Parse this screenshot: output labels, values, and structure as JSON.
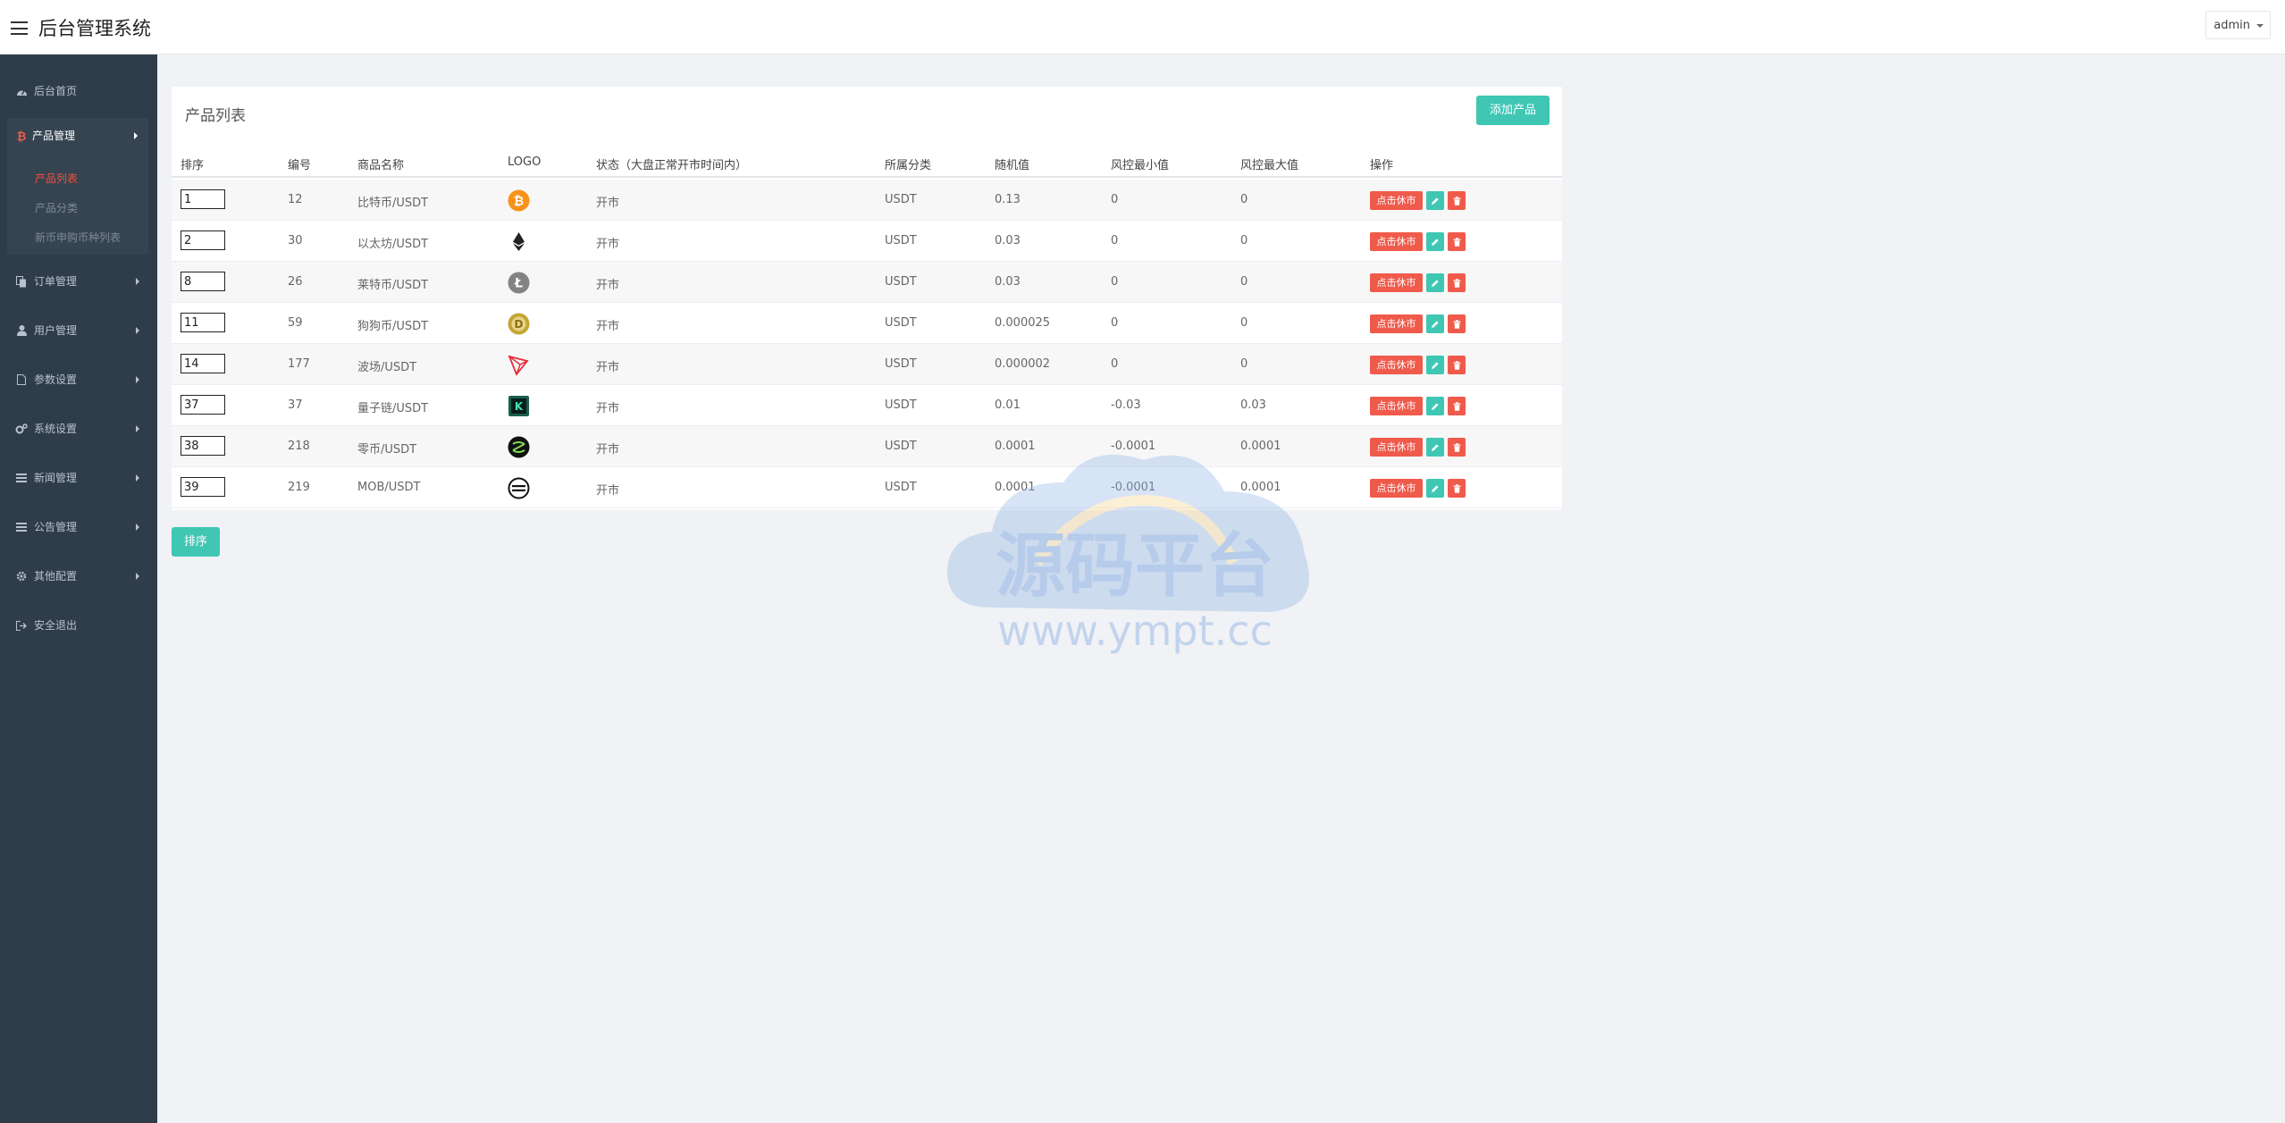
{
  "header": {
    "title": "后台管理系统",
    "user": "admin"
  },
  "sidebar": {
    "items": [
      {
        "label": "后台首页",
        "icon": "dashboard-icon"
      },
      {
        "label": "产品管理",
        "icon": "bitcoin-icon",
        "open": true,
        "children": [
          {
            "label": "产品列表",
            "active": true
          },
          {
            "label": "产品分类"
          },
          {
            "label": "新币申购币种列表"
          }
        ]
      },
      {
        "label": "订单管理",
        "icon": "copy-icon"
      },
      {
        "label": "用户管理",
        "icon": "user-icon"
      },
      {
        "label": "参数设置",
        "icon": "file-icon"
      },
      {
        "label": "系统设置",
        "icon": "cogs-icon"
      },
      {
        "label": "新闻管理",
        "icon": "list-icon"
      },
      {
        "label": "公告管理",
        "icon": "list-icon"
      },
      {
        "label": "其他配置",
        "icon": "gear-icon"
      },
      {
        "label": "安全退出",
        "icon": "sign-out-icon"
      }
    ]
  },
  "panel": {
    "title": "产品列表",
    "add_label": "添加产品",
    "columns": [
      "排序",
      "编号",
      "商品名称",
      "LOGO",
      "状态（大盘正常开市时间内）",
      "所属分类",
      "随机值",
      "风控最小值",
      "风控最大值",
      "操作"
    ],
    "rows": [
      {
        "sort": "1",
        "id": "12",
        "name": "比特币/USDT",
        "logo": "btc-logo",
        "status": "开市",
        "category": "USDT",
        "random": "0.13",
        "min": "0",
        "max": "0"
      },
      {
        "sort": "2",
        "id": "30",
        "name": "以太坊/USDT",
        "logo": "eth-logo",
        "status": "开市",
        "category": "USDT",
        "random": "0.03",
        "min": "0",
        "max": "0"
      },
      {
        "sort": "8",
        "id": "26",
        "name": "莱特币/USDT",
        "logo": "ltc-logo",
        "status": "开市",
        "category": "USDT",
        "random": "0.03",
        "min": "0",
        "max": "0"
      },
      {
        "sort": "11",
        "id": "59",
        "name": "狗狗币/USDT",
        "logo": "doge-logo",
        "status": "开市",
        "category": "USDT",
        "random": "0.000025",
        "min": "0",
        "max": "0"
      },
      {
        "sort": "14",
        "id": "177",
        "name": "波场/USDT",
        "logo": "trx-logo",
        "status": "开市",
        "category": "USDT",
        "random": "0.000002",
        "min": "0",
        "max": "0"
      },
      {
        "sort": "37",
        "id": "37",
        "name": "量子链/USDT",
        "logo": "qtum-logo",
        "status": "开市",
        "category": "USDT",
        "random": "0.01",
        "min": "-0.03",
        "max": "0.03"
      },
      {
        "sort": "38",
        "id": "218",
        "name": "零币/USDT",
        "logo": "zec-logo",
        "status": "开市",
        "category": "USDT",
        "random": "0.0001",
        "min": "-0.0001",
        "max": "0.0001"
      },
      {
        "sort": "39",
        "id": "219",
        "name": "MOB/USDT",
        "logo": "mob-logo",
        "status": "开市",
        "category": "USDT",
        "random": "0.0001",
        "min": "-0.0001",
        "max": "0.0001"
      }
    ],
    "action_halt": "点击休市",
    "action_edit_icon": "pencil-icon",
    "action_delete_icon": "trash-icon"
  },
  "sort_button": "排序",
  "watermark": {
    "title": "源码平台",
    "url": "www.ympt.cc"
  },
  "colors": {
    "accent": "#3fc7b4",
    "danger": "#f05a4b",
    "sidebar": "#2f3d4a"
  }
}
